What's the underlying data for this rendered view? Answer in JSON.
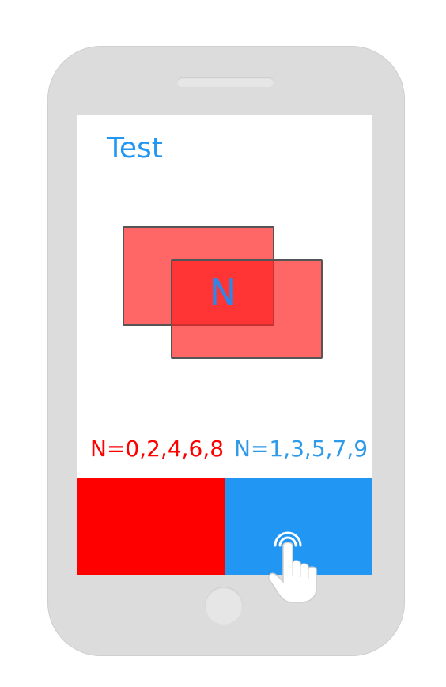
{
  "screen": {
    "title": "Test",
    "stimulus_letter": "N",
    "rules": {
      "even": "N=0,2,4,6,8",
      "odd": "N=1,3,5,7,9"
    }
  },
  "colors": {
    "accent_blue": "#2196f3",
    "accent_red": "#ff0000",
    "phone_body": "#dcdcdc"
  },
  "icons": [
    "tap-hand-icon"
  ]
}
